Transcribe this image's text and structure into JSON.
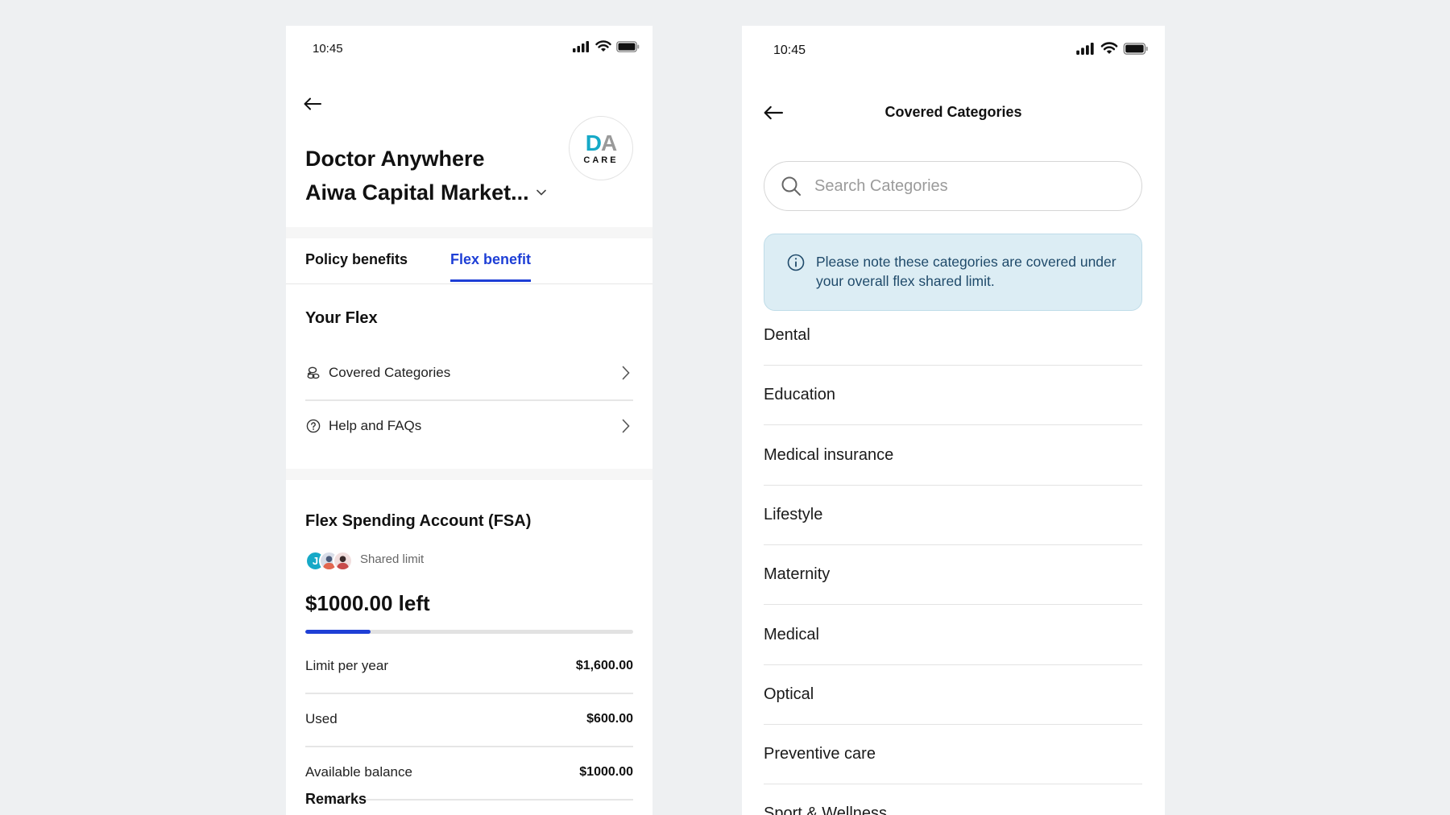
{
  "left_screen": {
    "status_time": "10:45",
    "org_name": "Doctor Anywhere",
    "org_sub": "Aiwa Capital Market...",
    "logo": {
      "initials_d": "D",
      "initials_a": "A",
      "care": "CARE"
    },
    "tabs": [
      {
        "label": "Policy benefits",
        "active": false
      },
      {
        "label": "Flex benefit",
        "active": true
      }
    ],
    "your_flex": {
      "title": "Your Flex",
      "items": [
        {
          "label": "Covered Categories",
          "icon": "coins-icon"
        },
        {
          "label": "Help and FAQs",
          "icon": "question-circle-icon"
        }
      ]
    },
    "fsa": {
      "title": "Flex Spending Account (FSA)",
      "avatar_initial": "J",
      "shared_label": "Shared limit",
      "amount_left": "$1000.00 left",
      "progress_fraction": 0.2,
      "rows": [
        {
          "label": "Limit per year",
          "value": "$1,600.00"
        },
        {
          "label": "Used",
          "value": "$600.00"
        },
        {
          "label": "Available balance",
          "value": "$1000.00"
        }
      ],
      "remarks_label": "Remarks"
    }
  },
  "right_screen": {
    "status_time": "10:45",
    "title": "Covered Categories",
    "search_placeholder": "Search Categories",
    "info_text": "Please note these categories are covered under your overall flex shared limit.",
    "categories": [
      "Dental",
      "Education",
      "Medical insurance",
      "Lifestyle",
      "Maternity",
      "Medical",
      "Optical",
      "Preventive care",
      "Sport & Wellness"
    ]
  },
  "colors": {
    "accent": "#1e3fd6",
    "brand_teal": "#16a9c7",
    "info_bg": "#dcedf4",
    "info_text": "#1f4a6a",
    "page_bg": "#eef0f2"
  }
}
